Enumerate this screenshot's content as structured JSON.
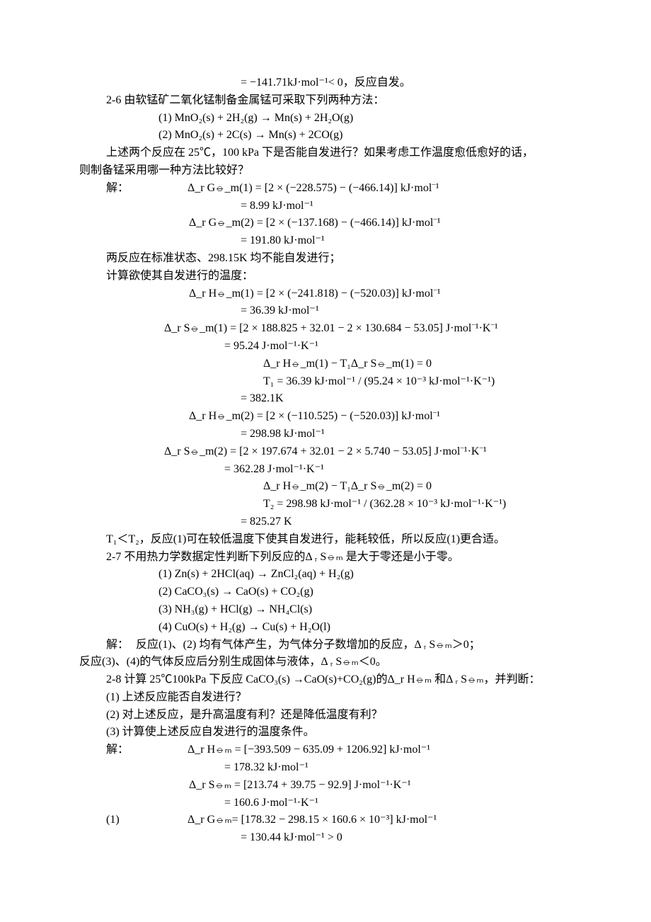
{
  "l1": "= −141.71kJ·mol⁻¹< 0，反应自发。",
  "l2": "2-6  由软锰矿二氧化锰制备金属锰可采取下列两种方法：",
  "l3": "(1)   MnO₂(s) + 2H₂(g) → Mn(s) + 2H₂O(g)",
  "l4": "(2)   MnO₂(s) + 2C(s) → Mn(s) + 2CO(g)",
  "l5": "上述两个反应在 25℃，100 kPa 下是否能自发进行？如果考虑工作温度愈低愈好的话，",
  "l6": "则制备锰采用哪一种方法比较好？",
  "l7a": "解：",
  "l7b": "Δ_r G⦵_m(1) = [2 × (−228.575) − (−466.14)] kJ·mol⁻¹",
  "l8": "= 8.99 kJ·mol⁻¹",
  "l9": "Δ_r G⦵_m(2) = [2 × (−137.168) − (−466.14)] kJ·mol⁻¹",
  "l10": "= 191.80 kJ·mol⁻¹",
  "l11": "两反应在标准状态、298.15K 均不能自发进行；",
  "l12": "计算欲使其自发进行的温度：",
  "l13": "Δ_r H⦵_m(1) = [2 × (−241.818) − (−520.03)] kJ·mol⁻¹",
  "l14": "= 36.39 kJ·mol⁻¹",
  "l15": "Δ_r S⦵_m(1) = [2 × 188.825 + 32.01 − 2 × 130.684 − 53.05] J·mol⁻¹·K⁻¹",
  "l16": "= 95.24 J·mol⁻¹·K⁻¹",
  "l17": "Δ_r H⦵_m(1) − T₁Δ_r S⦵_m(1) = 0",
  "l18": "T₁ = 36.39 kJ·mol⁻¹ / (95.24 × 10⁻³ kJ·mol⁻¹·K⁻¹)",
  "l19": "= 382.1K",
  "l20": "Δ_r H⦵_m(2) = [2 × (−110.525) − (−520.03)] kJ·mol⁻¹",
  "l21": "= 298.98 kJ·mol⁻¹",
  "l22": "Δ_r S⦵_m(2) = [2 × 197.674 + 32.01 − 2 × 5.740 − 53.05] J·mol⁻¹·K⁻¹",
  "l23": "= 362.28 J·mol⁻¹·K⁻¹",
  "l24": "Δ_r H⦵_m(2) − T₁Δ_r S⦵_m(2) = 0",
  "l25": "T₂ = 298.98 kJ·mol⁻¹ / (362.28 × 10⁻³ kJ·mol⁻¹·K⁻¹)",
  "l26": "= 825.27 K",
  "l27": "T₁＜T₂，反应(1)可在较低温度下使其自发进行，能耗较低，所以反应(1)更合适。",
  "l28": "2-7  不用热力学数据定性判断下列反应的Δ ᵣ S⦵ₘ 是大于零还是小于零。",
  "l29": "(1)   Zn(s) + 2HCl(aq) → ZnCl₂(aq) + H₂(g)",
  "l30": "(2)   CaCO₃(s) → CaO(s) + CO₂(g)",
  "l31": "(3)   NH₃(g) + HCl(g) → NH₄Cl(s)",
  "l32": "(4)   CuO(s) + H₂(g) → Cu(s) + H₂O(l)",
  "l33a": "解：",
  "l33b": "反应(1)、(2) 均有气体产生，为气体分子数增加的反应，Δ ᵣ S⦵ₘ＞0；",
  "l34": "反应(3)、(4)的气体反应后分别生成固体与液体，Δ ᵣ S⦵ₘ＜0。",
  "l35": "2-8  计算 25℃100kPa 下反应 CaCO₃(s) →CaO(s)+CO₂(g)的Δ_r H⦵ₘ 和Δ ᵣ S⦵ₘ，并判断：",
  "l36": "(1)   上述反应能否自发进行？",
  "l37": "(2)   对上述反应，是升高温度有利？还是降低温度有利？",
  "l38": "(3)   计算使上述反应自发进行的温度条件。",
  "l39a": "解：",
  "l39b": "Δ_r H⦵ₘ = [−393.509 − 635.09 + 1206.92] kJ·mol⁻¹",
  "l40": "= 178.32 kJ·mol⁻¹",
  "l41": "Δ_r S⦵ₘ = [213.74 + 39.75 − 92.9] J·mol⁻¹·K⁻¹",
  "l42": "= 160.6 J·mol⁻¹·K⁻¹",
  "l43a": "(1)",
  "l43b": "Δ_r G⦵ₘ= [178.32 − 298.15 × 160.6 × 10⁻³] kJ·mol⁻¹",
  "l44": "= 130.44 kJ·mol⁻¹ > 0"
}
